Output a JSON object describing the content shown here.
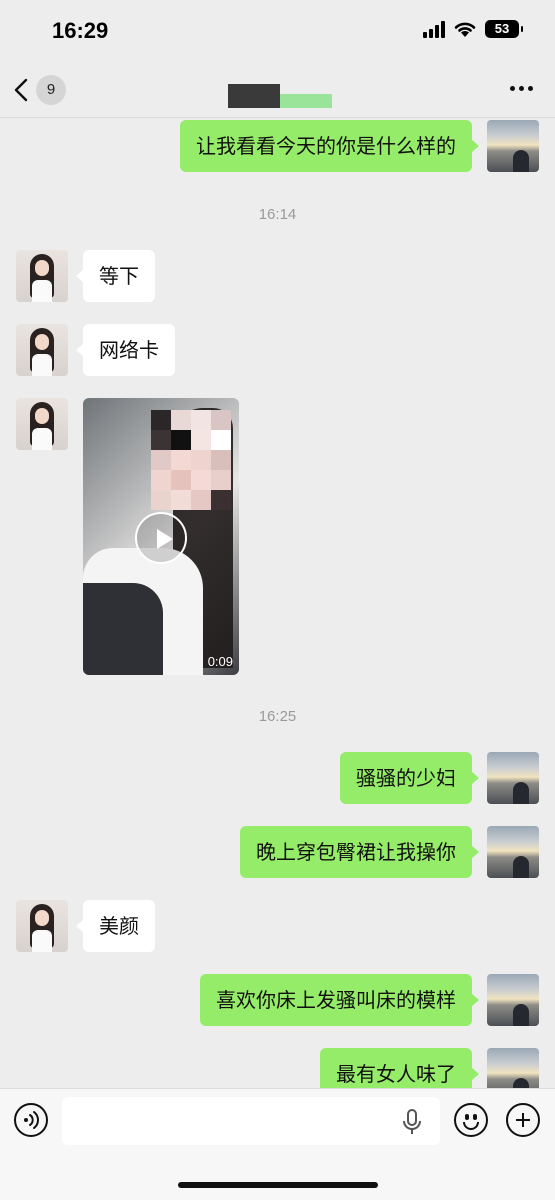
{
  "status_bar": {
    "time": "16:29",
    "battery": "53"
  },
  "nav": {
    "unread_count": "9"
  },
  "timestamps": [
    "16:14",
    "16:25"
  ],
  "messages": [
    {
      "from": "me",
      "text": "让我看看今天的你是什么样的"
    },
    {
      "from": "her",
      "text": "等下"
    },
    {
      "from": "her",
      "text": "网络卡"
    },
    {
      "from": "her",
      "type": "video",
      "duration": "0:09"
    },
    {
      "from": "me",
      "text": "骚骚的少妇"
    },
    {
      "from": "me",
      "text": "晚上穿包臀裙让我操你"
    },
    {
      "from": "her",
      "text": "美颜"
    },
    {
      "from": "me",
      "text": "喜欢你床上发骚叫床的模样"
    },
    {
      "from": "me",
      "text": "最有女人味了"
    }
  ],
  "input_bar": {
    "placeholder": ""
  },
  "icons": [
    "chevron-left-icon",
    "more-icon",
    "voice-icon",
    "mic-icon",
    "emoji-icon",
    "plus-icon",
    "play-icon"
  ],
  "colors": {
    "background": "#ededed",
    "bubble_me": "#95ec69",
    "bubble_her": "#ffffff"
  }
}
